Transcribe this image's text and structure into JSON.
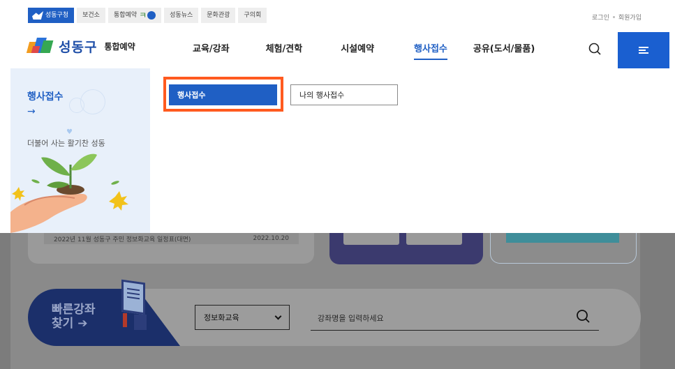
{
  "topbar": {
    "site_tabs": [
      {
        "label": "성동구청",
        "active": true
      },
      {
        "label": "보건소",
        "active": false
      },
      {
        "label": "통합예약",
        "active": false
      },
      {
        "label": "성동뉴스",
        "active": false
      },
      {
        "label": "문화관광",
        "active": false
      },
      {
        "label": "구의회",
        "active": false
      }
    ],
    "login": "로그인",
    "signup": "회원가입"
  },
  "header": {
    "logo_name": "성동구",
    "logo_sub": "통합예약",
    "nav": [
      {
        "label": "교육/강좌"
      },
      {
        "label": "체험/견학"
      },
      {
        "label": "시설예약"
      },
      {
        "label": "행사접수"
      },
      {
        "label": "공유(도서/물품)"
      }
    ],
    "active_nav": "행사접수"
  },
  "dropdown": {
    "side_title": "행사접수",
    "side_arrow": "→",
    "side_desc": "더불어 사는 활기찬 성동",
    "items": [
      {
        "label": "행사접수",
        "selected": true
      },
      {
        "label": "나의 행사접수",
        "selected": false
      }
    ]
  },
  "background": {
    "notice_text": "2022년 11월 성동구 주민 정보화교육 일정표(대면)",
    "notice_date": "2022.10.20"
  },
  "quick_search": {
    "label": "빠른강좌 찾기 ➔",
    "category_value": "정보화교육",
    "placeholder": "강좌명을 입력하세요"
  },
  "colors": {
    "brand_blue": "#1f5fc4",
    "highlight_orange": "#ff5a1f",
    "navy": "#1b2f6a"
  }
}
